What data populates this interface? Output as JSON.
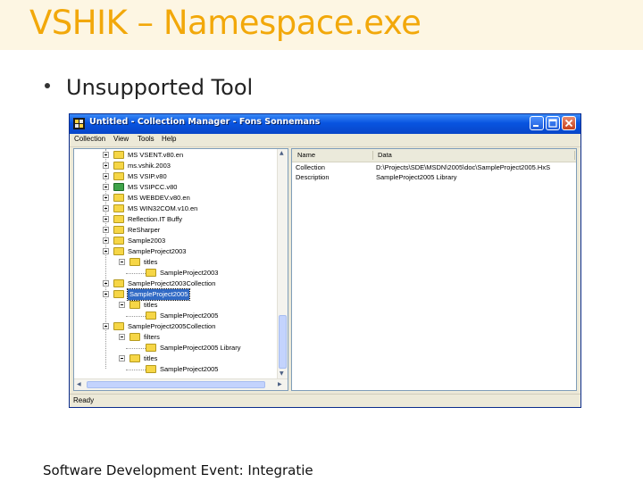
{
  "slide": {
    "title": "VSHIK – Namespace.exe",
    "bullet": "Unsupported Tool",
    "footer": "Software Development Event: Integratie"
  },
  "window": {
    "title": "Untitled - Collection Manager - Fons Sonnemans",
    "menu": [
      "Collection",
      "View",
      "Tools",
      "Help"
    ],
    "status": "Ready"
  },
  "tree": [
    {
      "label": "MS VSENT.v80.en",
      "depth": 0,
      "expander": "plus",
      "icon": "folder"
    },
    {
      "label": "ms.vshik.2003",
      "depth": 0,
      "expander": "plus",
      "icon": "folder"
    },
    {
      "label": "MS VSIP.v80",
      "depth": 0,
      "expander": "plus",
      "icon": "folder"
    },
    {
      "label": "MS VSIPCC.v80",
      "depth": 0,
      "expander": "plus",
      "icon": "folder-green"
    },
    {
      "label": "MS WEBDEV.v80.en",
      "depth": 0,
      "expander": "plus",
      "icon": "folder"
    },
    {
      "label": "MS WIN32COM.v10.en",
      "depth": 0,
      "expander": "plus",
      "icon": "folder"
    },
    {
      "label": "Reflection.IT Buffy",
      "depth": 0,
      "expander": "plus",
      "icon": "folder"
    },
    {
      "label": "ReSharper",
      "depth": 0,
      "expander": "plus",
      "icon": "folder"
    },
    {
      "label": "Sample2003",
      "depth": 0,
      "expander": "plus",
      "icon": "folder"
    },
    {
      "label": "SampleProject2003",
      "depth": 0,
      "expander": "minus",
      "icon": "folder"
    },
    {
      "label": "titles",
      "depth": 1,
      "expander": "minus",
      "icon": "folder"
    },
    {
      "label": "SampleProject2003",
      "depth": 2,
      "expander": "none",
      "icon": "folder"
    },
    {
      "label": "SampleProject2003Collection",
      "depth": 0,
      "expander": "plus",
      "icon": "folder"
    },
    {
      "label": "SampleProject2005",
      "depth": 0,
      "expander": "minus",
      "icon": "folder",
      "selected": true
    },
    {
      "label": "titles",
      "depth": 1,
      "expander": "minus",
      "icon": "folder"
    },
    {
      "label": "SampleProject2005",
      "depth": 2,
      "expander": "none",
      "icon": "folder"
    },
    {
      "label": "SampleProject2005Collection",
      "depth": 0,
      "expander": "minus",
      "icon": "folder"
    },
    {
      "label": "filters",
      "depth": 1,
      "expander": "minus",
      "icon": "folder"
    },
    {
      "label": "SampleProject2005 Library",
      "depth": 2,
      "expander": "none",
      "icon": "folder"
    },
    {
      "label": "titles",
      "depth": 1,
      "expander": "minus",
      "icon": "folder"
    },
    {
      "label": "SampleProject2005",
      "depth": 2,
      "expander": "none",
      "icon": "folder"
    }
  ],
  "list": {
    "columns": [
      "Name",
      "Data"
    ],
    "rows": [
      [
        "Collection",
        "D:\\Projects\\SDE\\MSDN\\2005\\doc\\SampleProject2005.HxS"
      ],
      [
        "Description",
        "SampleProject2005 Library"
      ]
    ]
  },
  "colors": {
    "title": "#f2a80a",
    "title_band": "#fdf6e3",
    "titlebar": "#0854e0",
    "selection": "#316ac5"
  }
}
